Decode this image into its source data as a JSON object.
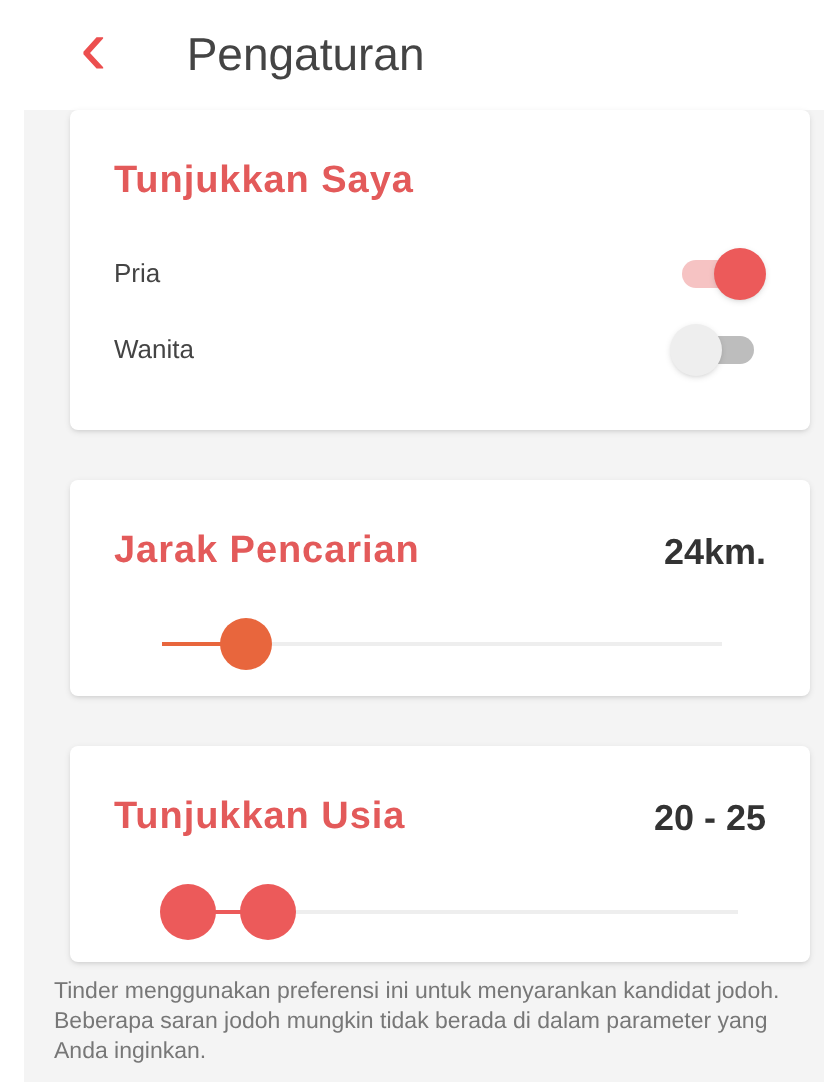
{
  "header": {
    "back_icon": "‹",
    "title": "Pengaturan"
  },
  "show_me": {
    "title": "Tunjukkan Saya",
    "options": [
      {
        "label": "Pria",
        "on": true
      },
      {
        "label": "Wanita",
        "on": false
      }
    ]
  },
  "distance": {
    "title": "Jarak Pencarian",
    "reading": "24km.",
    "level": 0.15
  },
  "age": {
    "title": "Tunjukkan Usia",
    "reading": "20 - 25",
    "thumbs": [
      {
        "level": 0.04
      },
      {
        "level": 0.18
      }
    ]
  },
  "footnote": "Tinder menggunakan preferensi ini untuk menyarankan kandidat jodoh. Beberapa saran jodoh mungkin tidak berada di dalam parameter yang Anda inginkan."
}
